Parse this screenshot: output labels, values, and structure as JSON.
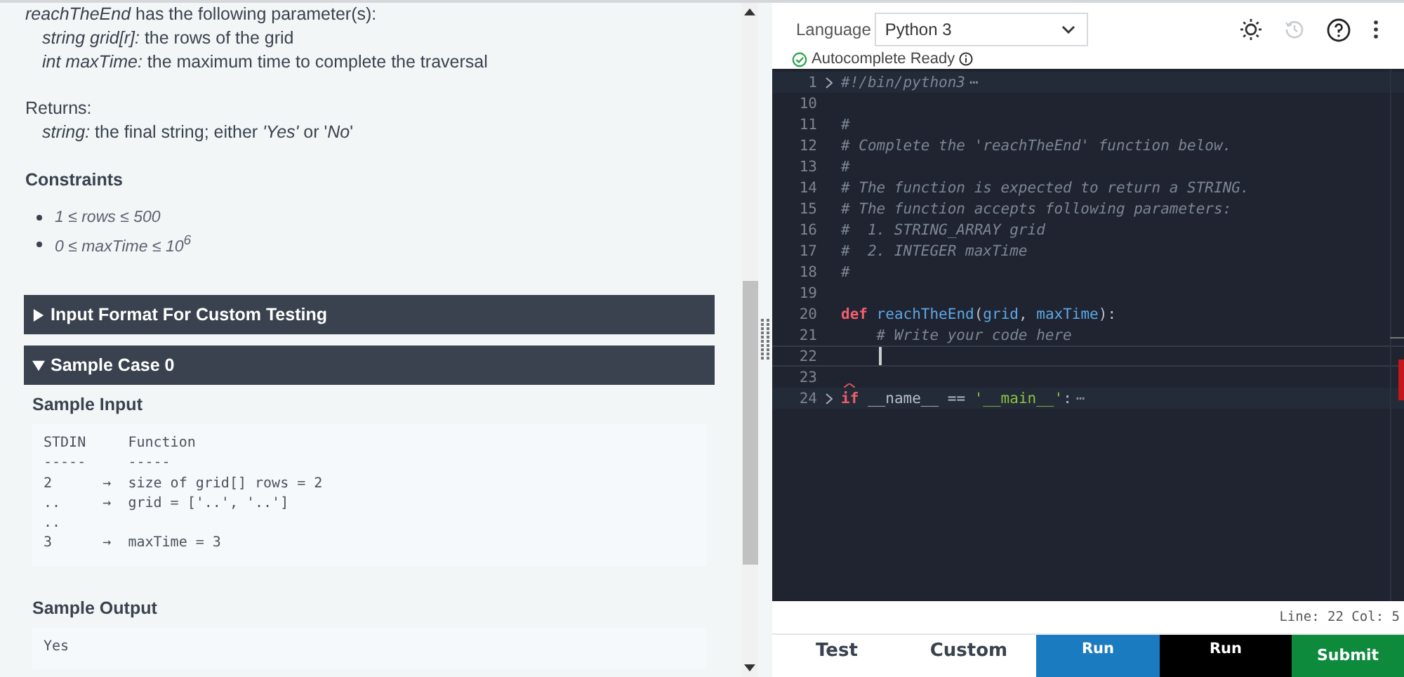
{
  "description": {
    "signature": "*reachTheEnd* has the following parameter(s):",
    "params": [
      "*string grid[r]:* the rows of the grid",
      "*int maxTime:* the maximum time to complete the traversal"
    ],
    "returns_label": "Returns:",
    "returns": [
      "*string:* the final string; either *'Yes'* or '*No*'"
    ]
  },
  "constraints": {
    "title": "Constraints",
    "items": [
      "1 ≤ rows ≤ 500",
      "0 ≤ maxTime ≤ 10$^{6}$"
    ]
  },
  "sections": [
    {
      "title": "Input Format For Custom Testing",
      "expanded": false
    },
    {
      "title": "Sample Case 0",
      "expanded": true,
      "content": [
        {
          "title": "Sample Input",
          "lines": [
            "STDIN     Function",
            "-----     -----",
            "2      →  size of grid[] rows = 2",
            "..     →  grid = ['..', '..']",
            "..",
            "3      →  maxTime = 3"
          ]
        },
        {
          "title": "Sample Output",
          "lines": [
            "Yes"
          ]
        }
      ]
    }
  ],
  "editor": {
    "language": {
      "label": "Language",
      "value": "Python 3"
    },
    "autocomplete": "Autocomplete Ready",
    "history": {
      "disabled": true
    },
    "lines": [
      {
        "number": "1",
        "fold": true,
        "current": false,
        "tokens": [
          {
            "text": "#!/bin/python3",
            "kind": "comment"
          },
          {
            "text": "⋯",
            "kind": "fold"
          }
        ]
      },
      {
        "number": "10",
        "fold": false,
        "current": false
      },
      {
        "number": "11",
        "fold": false,
        "current": false,
        "tokens": [
          {
            "text": "#",
            "kind": "comment"
          }
        ]
      },
      {
        "number": "12",
        "fold": false,
        "current": false,
        "tokens": [
          {
            "text": "# Complete the 'reachTheEnd' function below.",
            "kind": "comment"
          }
        ]
      },
      {
        "number": "13",
        "fold": false,
        "current": false,
        "tokens": [
          {
            "text": "#",
            "kind": "comment"
          }
        ]
      },
      {
        "number": "14",
        "fold": false,
        "current": false,
        "tokens": [
          {
            "text": "# The function is expected to return a STRING.",
            "kind": "comment"
          }
        ]
      },
      {
        "number": "15",
        "fold": false,
        "current": false,
        "tokens": [
          {
            "text": "# The function accepts following parameters:",
            "kind": "comment"
          }
        ]
      },
      {
        "number": "16",
        "fold": false,
        "current": false,
        "tokens": [
          {
            "text": "#  1. STRING_ARRAY grid",
            "kind": "comment"
          }
        ]
      },
      {
        "number": "17",
        "fold": false,
        "current": false,
        "tokens": [
          {
            "text": "#  2. INTEGER maxTime",
            "kind": "comment"
          }
        ]
      },
      {
        "number": "18",
        "fold": false,
        "current": false,
        "tokens": [
          {
            "text": "#",
            "kind": "comment"
          }
        ]
      },
      {
        "number": "19",
        "fold": false,
        "current": false
      },
      {
        "number": "20",
        "fold": false,
        "current": false,
        "tokens": [
          {
            "text": "def ",
            "kind": "keyword"
          },
          {
            "text": "reachTheEnd",
            "kind": "name"
          },
          {
            "text": "(",
            "kind": "plain"
          },
          {
            "text": "grid",
            "kind": "name"
          },
          {
            "text": ", ",
            "kind": "plain"
          },
          {
            "text": "maxTime",
            "kind": "name"
          },
          {
            "text": "):",
            "kind": "plain"
          }
        ]
      },
      {
        "number": "21",
        "fold": false,
        "current": false,
        "tokens": [
          {
            "text": "    # Write your code here",
            "kind": "comment"
          }
        ]
      },
      {
        "number": "22",
        "fold": false,
        "current": true
      },
      {
        "number": "23",
        "fold": false,
        "current": false
      },
      {
        "number": "24",
        "fold": true,
        "current": false,
        "error": true,
        "tokens": [
          {
            "text": "if",
            "kind": "keyword"
          },
          {
            "text": " __name__ == ",
            "kind": "plain"
          },
          {
            "text": "'__main__'",
            "kind": "string"
          },
          {
            "text": ":",
            "kind": "plain"
          },
          {
            "text": "⋯",
            "kind": "fold"
          }
        ]
      }
    ],
    "status": "Line: 22 Col: 5"
  },
  "actions": [
    {
      "label": "Test",
      "kind": "tab"
    },
    {
      "label": "Custom",
      "kind": "tab"
    },
    {
      "label": "Run",
      "kind": "primary"
    },
    {
      "label": "Run",
      "kind": "dark"
    },
    {
      "label": "Submit",
      "kind": "success"
    }
  ]
}
